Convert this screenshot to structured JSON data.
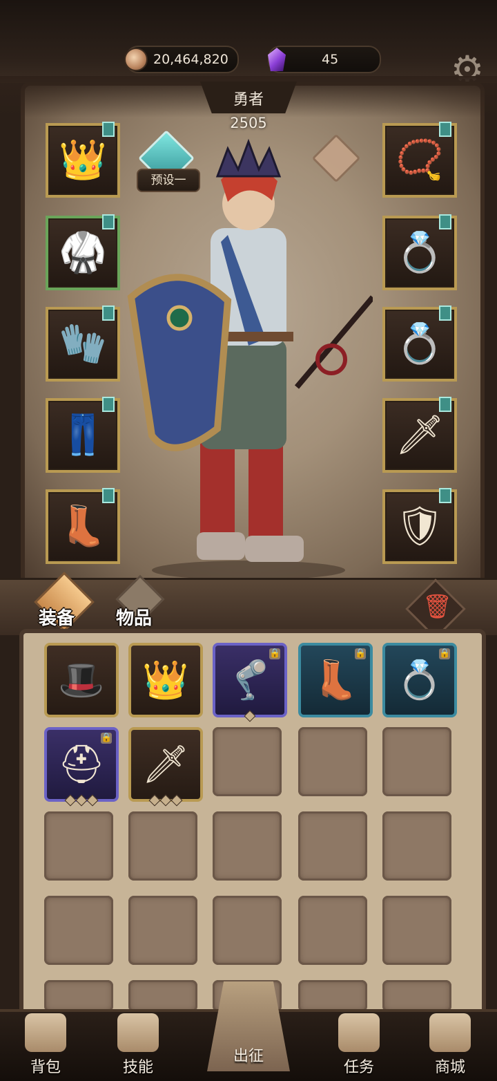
{
  "resources": {
    "gold": "20,464,820",
    "gems": "45"
  },
  "hero": {
    "name": "勇者",
    "power": "2505",
    "preset_label": "预设一"
  },
  "tabs": {
    "equipment": "装备",
    "items": "物品"
  },
  "equipment_slots_left": [
    {
      "name": "crown-slot",
      "icon": "crown"
    },
    {
      "name": "armor-slot",
      "icon": "armor"
    },
    {
      "name": "gloves-slot",
      "icon": "gloves"
    },
    {
      "name": "pants-slot",
      "icon": "pants"
    },
    {
      "name": "boots-slot",
      "icon": "boots"
    }
  ],
  "equipment_slots_right": [
    {
      "name": "necklace-slot",
      "icon": "necklace"
    },
    {
      "name": "ring-slot-1",
      "icon": "ring"
    },
    {
      "name": "ring-slot-2",
      "icon": "ring"
    },
    {
      "name": "weapon-slot",
      "icon": "sword"
    },
    {
      "name": "shield-slot",
      "icon": "shield"
    }
  ],
  "inventory_items": [
    {
      "name": "hat",
      "rarity": "gold",
      "locked": false,
      "pips": 0
    },
    {
      "name": "spiked-helm",
      "rarity": "gold",
      "locked": false,
      "pips": 0
    },
    {
      "name": "leg-guard",
      "rarity": "purple",
      "locked": true,
      "pips": 1
    },
    {
      "name": "boots",
      "rarity": "teal",
      "locked": true,
      "pips": 0
    },
    {
      "name": "star-ring",
      "rarity": "teal",
      "locked": true,
      "pips": 0
    },
    {
      "name": "helmet",
      "rarity": "purple",
      "locked": true,
      "pips": 3
    },
    {
      "name": "dark-blade",
      "rarity": "gold",
      "locked": false,
      "pips": 3
    }
  ],
  "nav": {
    "bag": "背包",
    "skills": "技能",
    "expedition": "出征",
    "quests": "任务",
    "shop": "商城"
  },
  "colors": {
    "panel_bg": "#a39079",
    "slot_border_gold": "#b99a52",
    "slot_border_green": "#6aa55a",
    "rarity_purple": "#6b62c6",
    "rarity_teal": "#3c8ba0",
    "trash_red": "#e2523f"
  }
}
